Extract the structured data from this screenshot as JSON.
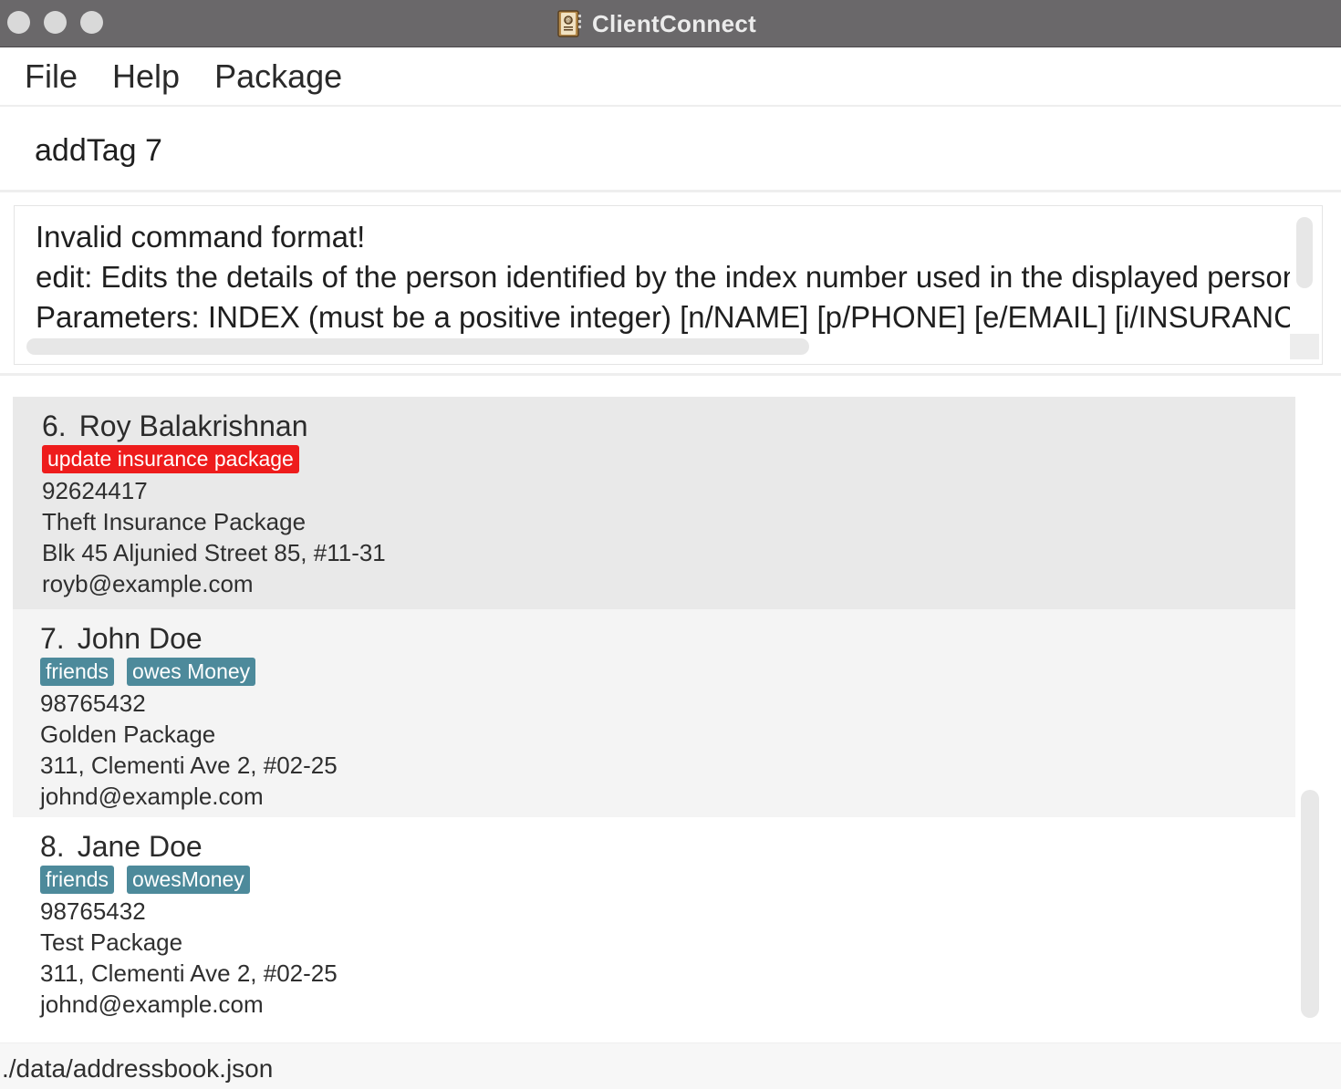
{
  "window": {
    "title": "ClientConnect",
    "icon": "address-book-icon"
  },
  "menu": {
    "items": [
      "File",
      "Help",
      "Package"
    ]
  },
  "command": {
    "value": "addTag 7"
  },
  "result": {
    "lines": [
      "Invalid command format!",
      "edit: Edits the details of the person identified by the index number used in the displayed person list.",
      "Parameters: INDEX (must be a positive integer) [n/NAME] [p/PHONE] [e/EMAIL] [i/INSURANCE"
    ]
  },
  "persons": [
    {
      "index": "6.",
      "name": "Roy Balakrishnan",
      "tags": [
        {
          "label": "update insurance package",
          "color": "#ee1c1c"
        }
      ],
      "phone": "92624417",
      "package": "Theft Insurance Package",
      "address": "Blk 45 Aljunied Street 85, #11-31",
      "email": "royb@example.com"
    },
    {
      "index": "7.",
      "name": "John Doe",
      "tags": [
        {
          "label": "friends",
          "color": "#4d8a9b"
        },
        {
          "label": "owes Money",
          "color": "#4d8a9b"
        }
      ],
      "phone": "98765432",
      "package": "Golden Package",
      "address": "311, Clementi Ave 2, #02-25",
      "email": "johnd@example.com"
    },
    {
      "index": "8.",
      "name": "Jane Doe",
      "tags": [
        {
          "label": "friends",
          "color": "#4d8a9b"
        },
        {
          "label": "owesMoney",
          "color": "#4d8a9b"
        }
      ],
      "phone": "98765432",
      "package": "Test Package",
      "address": "311, Clementi Ave 2, #02-25",
      "email": "johnd@example.com"
    }
  ],
  "status": {
    "path": "./data/addressbook.json"
  },
  "colors": {
    "titlebar": "#6a686a",
    "tag_default": "#4d8a9b",
    "tag_alert": "#ee1c1c",
    "selected_card": "#e9e9e9"
  }
}
